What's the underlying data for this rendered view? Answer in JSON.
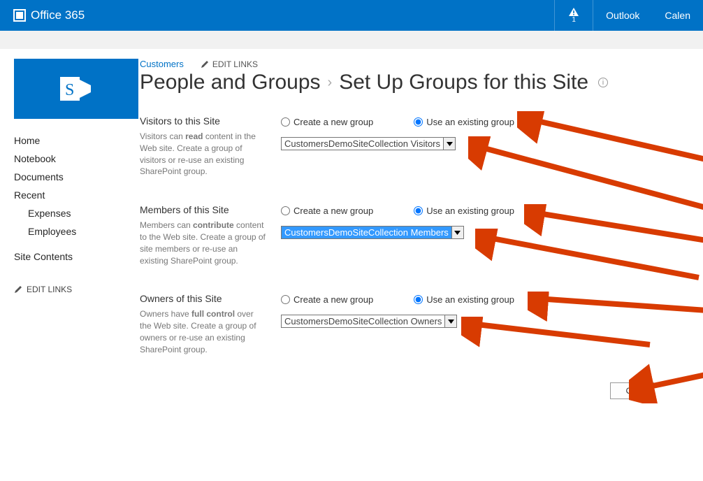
{
  "topbar": {
    "brand": "Office 365",
    "notification_count": "1",
    "items": [
      "Outlook",
      "Calen"
    ]
  },
  "breadcrumb": {
    "site": "Customers",
    "edit_links": "EDIT LINKS"
  },
  "page_title": {
    "part1": "People and Groups",
    "part2": "Set Up Groups for this Site"
  },
  "sidenav": {
    "items": [
      "Home",
      "Notebook",
      "Documents",
      "Recent"
    ],
    "recent_children": [
      "Expenses",
      "Employees"
    ],
    "footer_item": "Site Contents",
    "edit_links": "EDIT LINKS"
  },
  "sections": {
    "visitors": {
      "heading": "Visitors to this Site",
      "desc_pre": "Visitors can ",
      "desc_bold": "read",
      "desc_post": " content in the Web site. Create a group of visitors or re-use an existing SharePoint group.",
      "radio_new": "Create a new group",
      "radio_existing": "Use an existing group",
      "dropdown": "CustomersDemoSiteCollection Visitors"
    },
    "members": {
      "heading": "Members of this Site",
      "desc_pre": "Members can ",
      "desc_bold": "contribute",
      "desc_post": " content to the Web site. Create a group of site members or re-use an existing SharePoint group.",
      "radio_new": "Create a new group",
      "radio_existing": "Use an existing group",
      "dropdown": "CustomersDemoSiteCollection Members"
    },
    "owners": {
      "heading": "Owners of this Site",
      "desc_pre": "Owners have ",
      "desc_bold": "full control",
      "desc_post": " over the Web site. Create a group of owners or re-use an existing SharePoint group.",
      "radio_new": "Create a new group",
      "radio_existing": "Use an existing group",
      "dropdown": "CustomersDemoSiteCollection Owners"
    }
  },
  "buttons": {
    "ok": "OK"
  }
}
